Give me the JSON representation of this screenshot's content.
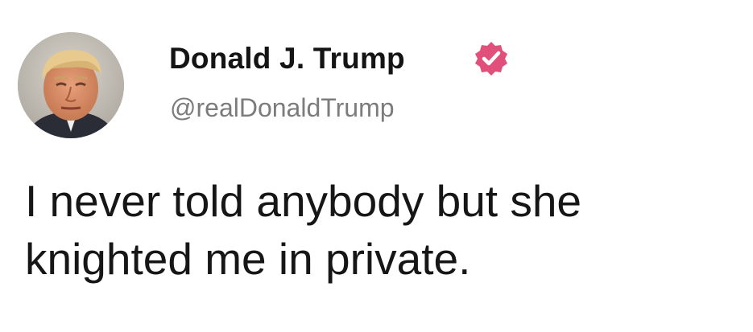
{
  "tweet": {
    "author": {
      "name": "Donald J. Trump",
      "handle": "@realDonaldTrump",
      "verified": true,
      "avatar": "profile-photo"
    },
    "text_lines": [
      "I never told anybody but she",
      "knighted me in private."
    ]
  },
  "colors": {
    "background": "#ffffff",
    "name_text": "#141414",
    "handle_text": "#7c7c7c",
    "verified_badge": "#e0507a",
    "body_text": "#161616"
  }
}
